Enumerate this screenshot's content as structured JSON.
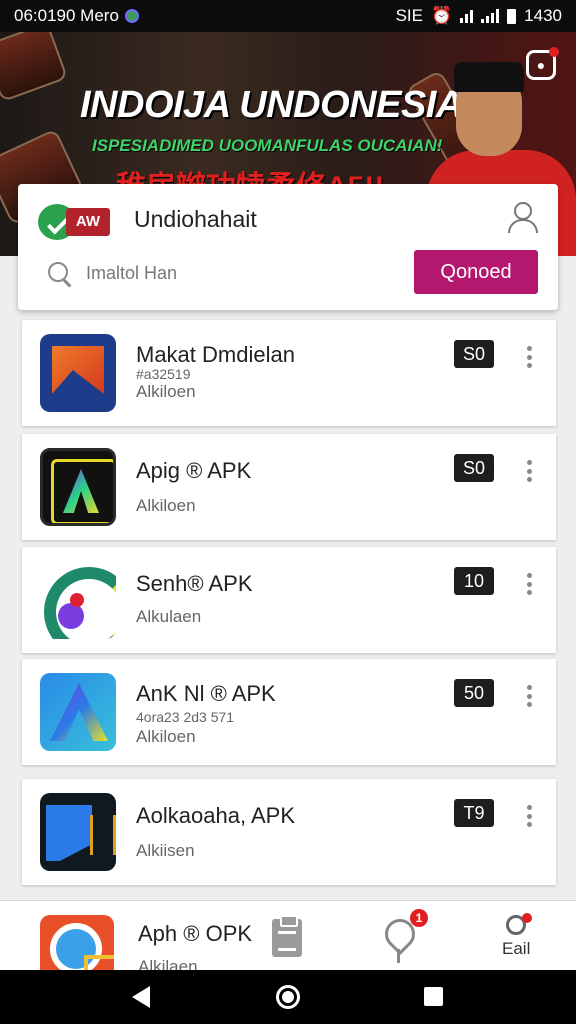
{
  "status_bar": {
    "time_left": "06:0190 Mero",
    "right_text": "1430",
    "sim_text": "SIE"
  },
  "banner": {
    "title": "INDOIJA UNDONESIAN",
    "subtitle": "ISPESIADIMED UOOMANFULAS OUCAIAN!",
    "tagline": "稚房辮功犊柔修A5!!"
  },
  "header": {
    "logo_text": "AW",
    "title": "Undiohahait"
  },
  "search": {
    "placeholder": "Imaltol Han",
    "button_label": "Qonoed"
  },
  "apps": [
    {
      "name": "Makat Dmdielan",
      "meta": "#a32519",
      "sub": "Alkiloen",
      "badge": "S0"
    },
    {
      "name": "Apig ® APK",
      "meta": "",
      "sub": "Alkiloen",
      "badge": "S0"
    },
    {
      "name": "Senh® APK",
      "meta": "",
      "sub": "Alkulaen",
      "badge": "10"
    },
    {
      "name": "AnK Nl ® APK",
      "meta": "4ora23 2d3 571",
      "sub": "Alkiloen",
      "badge": "50"
    },
    {
      "name": "Aolkaoaha, APK",
      "meta": "",
      "sub": "Alkiisen",
      "badge": "T9"
    }
  ],
  "bottom_bar": {
    "peek_name": "Aph ® OPK",
    "peek_sub": "Alkilaen",
    "notif_count": "1",
    "profile_label": "Eail"
  },
  "icons": {
    "app_1": "orange-arrow-app-icon",
    "app_2": "yellow-frame-a-app-icon",
    "app_3": "green-circle-app-icon",
    "app_4": "blue-triangle-a-app-icon",
    "app_5": "blue-dark-app-icon",
    "peek": "orange-camera-app-icon"
  },
  "colors": {
    "accent": "#b3186e",
    "badge": "#1e1e1e",
    "logo_green": "#2aa24d",
    "logo_red": "#b3232c",
    "notif": "#e02020"
  }
}
